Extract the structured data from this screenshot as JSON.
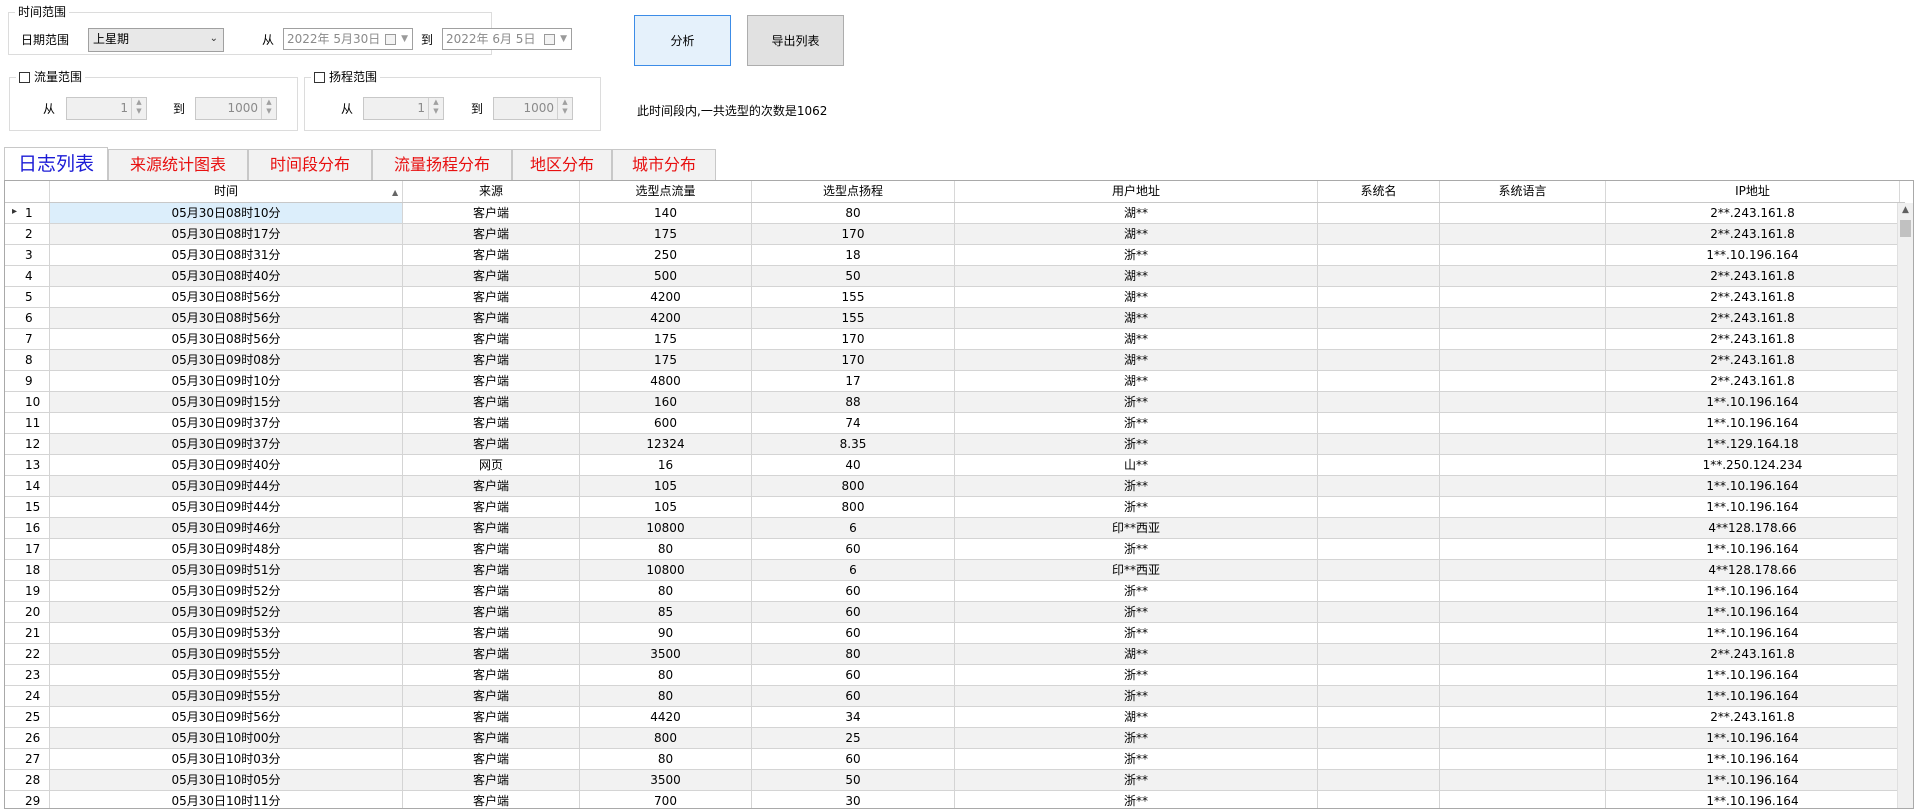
{
  "time_range": {
    "legend": "时间范围",
    "date_range_label": "日期范围",
    "date_range_value": "上星期",
    "from_label": "从",
    "from_date": "2022年 5月30日",
    "to_label": "到",
    "to_date": "2022年 6月 5日"
  },
  "flow_range": {
    "legend": "流量范围",
    "from_label": "从",
    "from_value": "1",
    "to_label": "到",
    "to_value": "1000"
  },
  "head_range": {
    "legend": "扬程范围",
    "from_label": "从",
    "from_value": "1",
    "to_label": "到",
    "to_value": "1000"
  },
  "actions": {
    "analyze_label": "分析",
    "export_label": "导出列表"
  },
  "summary_text": "此时间段内,一共选型的次数是1062",
  "tabs": [
    "日志列表",
    "来源统计图表",
    "时间段分布",
    "流量扬程分布",
    "地区分布",
    "城市分布"
  ],
  "columns": [
    "时间",
    "来源",
    "选型点流量",
    "选型点扬程",
    "用户地址",
    "系统名",
    "系统语言",
    "IP地址"
  ],
  "rows": [
    [
      "1",
      "05月30日08时10分",
      "客户端",
      "140",
      "80",
      "湖**",
      "",
      "",
      "2**.243.161.8"
    ],
    [
      "2",
      "05月30日08时17分",
      "客户端",
      "175",
      "170",
      "湖**",
      "",
      "",
      "2**.243.161.8"
    ],
    [
      "3",
      "05月30日08时31分",
      "客户端",
      "250",
      "18",
      "浙**",
      "",
      "",
      "1**.10.196.164"
    ],
    [
      "4",
      "05月30日08时40分",
      "客户端",
      "500",
      "50",
      "湖**",
      "",
      "",
      "2**.243.161.8"
    ],
    [
      "5",
      "05月30日08时56分",
      "客户端",
      "4200",
      "155",
      "湖**",
      "",
      "",
      "2**.243.161.8"
    ],
    [
      "6",
      "05月30日08时56分",
      "客户端",
      "4200",
      "155",
      "湖**",
      "",
      "",
      "2**.243.161.8"
    ],
    [
      "7",
      "05月30日08时56分",
      "客户端",
      "175",
      "170",
      "湖**",
      "",
      "",
      "2**.243.161.8"
    ],
    [
      "8",
      "05月30日09时08分",
      "客户端",
      "175",
      "170",
      "湖**",
      "",
      "",
      "2**.243.161.8"
    ],
    [
      "9",
      "05月30日09时10分",
      "客户端",
      "4800",
      "17",
      "湖**",
      "",
      "",
      "2**.243.161.8"
    ],
    [
      "10",
      "05月30日09时15分",
      "客户端",
      "160",
      "88",
      "浙**",
      "",
      "",
      "1**.10.196.164"
    ],
    [
      "11",
      "05月30日09时37分",
      "客户端",
      "600",
      "74",
      "浙**",
      "",
      "",
      "1**.10.196.164"
    ],
    [
      "12",
      "05月30日09时37分",
      "客户端",
      "12324",
      "8.35",
      "浙**",
      "",
      "",
      "1**.129.164.18"
    ],
    [
      "13",
      "05月30日09时40分",
      "网页",
      "16",
      "40",
      "山**",
      "",
      "",
      "1**.250.124.234"
    ],
    [
      "14",
      "05月30日09时44分",
      "客户端",
      "105",
      "800",
      "浙**",
      "",
      "",
      "1**.10.196.164"
    ],
    [
      "15",
      "05月30日09时44分",
      "客户端",
      "105",
      "800",
      "浙**",
      "",
      "",
      "1**.10.196.164"
    ],
    [
      "16",
      "05月30日09时46分",
      "客户端",
      "10800",
      "6",
      "印**西亚",
      "",
      "",
      "4**128.178.66"
    ],
    [
      "17",
      "05月30日09时48分",
      "客户端",
      "80",
      "60",
      "浙**",
      "",
      "",
      "1**.10.196.164"
    ],
    [
      "18",
      "05月30日09时51分",
      "客户端",
      "10800",
      "6",
      "印**西亚",
      "",
      "",
      "4**128.178.66"
    ],
    [
      "19",
      "05月30日09时52分",
      "客户端",
      "80",
      "60",
      "浙**",
      "",
      "",
      "1**.10.196.164"
    ],
    [
      "20",
      "05月30日09时52分",
      "客户端",
      "85",
      "60",
      "浙**",
      "",
      "",
      "1**.10.196.164"
    ],
    [
      "21",
      "05月30日09时53分",
      "客户端",
      "90",
      "60",
      "浙**",
      "",
      "",
      "1**.10.196.164"
    ],
    [
      "22",
      "05月30日09时55分",
      "客户端",
      "3500",
      "80",
      "湖**",
      "",
      "",
      "2**.243.161.8"
    ],
    [
      "23",
      "05月30日09时55分",
      "客户端",
      "80",
      "60",
      "浙**",
      "",
      "",
      "1**.10.196.164"
    ],
    [
      "24",
      "05月30日09时55分",
      "客户端",
      "80",
      "60",
      "浙**",
      "",
      "",
      "1**.10.196.164"
    ],
    [
      "25",
      "05月30日09时56分",
      "客户端",
      "4420",
      "34",
      "湖**",
      "",
      "",
      "2**.243.161.8"
    ],
    [
      "26",
      "05月30日10时00分",
      "客户端",
      "800",
      "25",
      "浙**",
      "",
      "",
      "1**.10.196.164"
    ],
    [
      "27",
      "05月30日10时03分",
      "客户端",
      "80",
      "60",
      "浙**",
      "",
      "",
      "1**.10.196.164"
    ],
    [
      "28",
      "05月30日10时05分",
      "客户端",
      "3500",
      "50",
      "浙**",
      "",
      "",
      "1**.10.196.164"
    ],
    [
      "29",
      "05月30日10时11分",
      "客户端",
      "700",
      "30",
      "浙**",
      "",
      "",
      "1**.10.196.164"
    ]
  ]
}
